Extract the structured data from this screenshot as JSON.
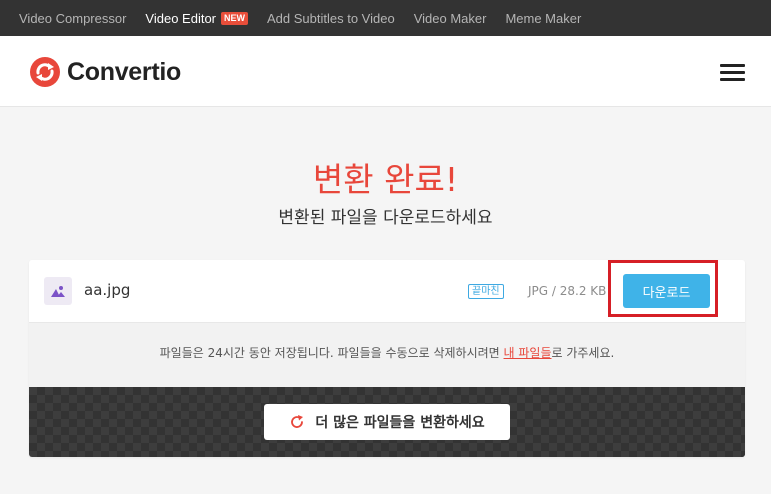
{
  "topnav": {
    "items": [
      {
        "label": "Video Compressor",
        "active": false
      },
      {
        "label": "Video Editor",
        "active": true,
        "badge": "NEW"
      },
      {
        "label": "Add Subtitles to Video",
        "active": false
      },
      {
        "label": "Video Maker",
        "active": false
      },
      {
        "label": "Meme Maker",
        "active": false
      }
    ]
  },
  "header": {
    "logo_text": "Convertio",
    "menu_icon": "hamburger-icon"
  },
  "main": {
    "title": "변환 완료!",
    "subtitle": "변환된 파일을 다운로드하세요"
  },
  "file": {
    "name": "aa.jpg",
    "icon": "image-file-icon",
    "status": "끝마친",
    "info": "JPG / 28.2 KB",
    "download_label": "다운로드"
  },
  "note": {
    "before": "파일들은 24시간 동안 저장됩니다. 파일들을 수동으로 삭제하시려면 ",
    "link": "내 파일들",
    "after": "로 가주세요."
  },
  "convert_more": {
    "label": "더 많은 파일들을 변환하세요",
    "icon": "refresh-icon"
  },
  "colors": {
    "accent_red": "#e8473b",
    "download_blue": "#3fb3e8",
    "highlight_border": "#d61f26",
    "topnav_bg": "#333333"
  }
}
